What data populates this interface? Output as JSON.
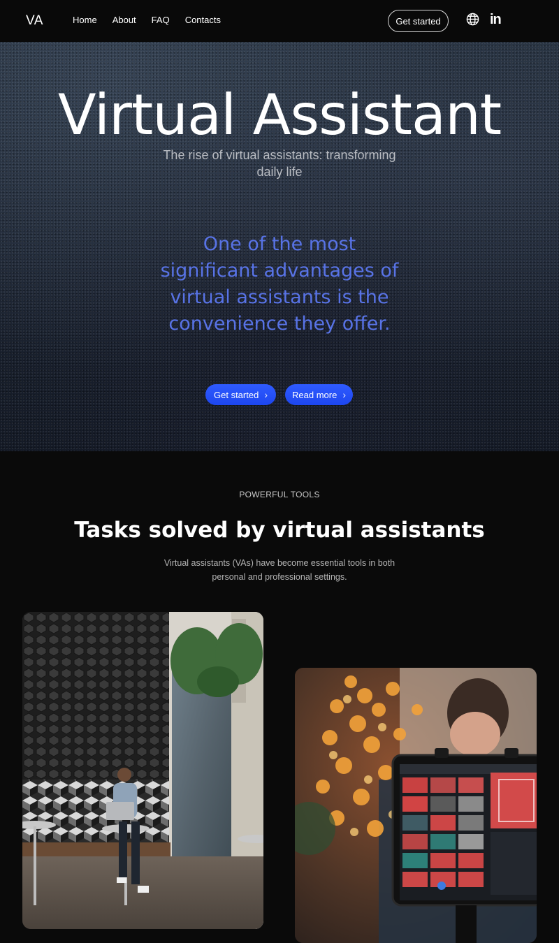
{
  "header": {
    "logo": "VA",
    "nav": [
      "Home",
      "About",
      "FAQ",
      "Contacts"
    ],
    "cta_label": "Get started",
    "icons": [
      "globe-icon",
      "linkedin-icon"
    ],
    "linkedin_text": "in"
  },
  "hero": {
    "title": "Virtual Assistant",
    "subtitle": "The rise of virtual assistants: transforming daily life",
    "quote": "One of the most significant advantages of virtual assistants is the convenience they offer.",
    "buttons": [
      {
        "label": "Get started",
        "icon": "chevron-right-icon"
      },
      {
        "label": "Read more",
        "icon": "chevron-right-icon"
      }
    ]
  },
  "tools": {
    "eyebrow": "POWERFUL TOOLS",
    "title": "Tasks solved by virtual assistants",
    "text": "Virtual assistants (VAs) have become essential tools in both personal and professional settings."
  },
  "colors": {
    "background": "#0a0a0a",
    "accent_blue": "#1d46ef",
    "quote_blue": "#5873e6"
  }
}
